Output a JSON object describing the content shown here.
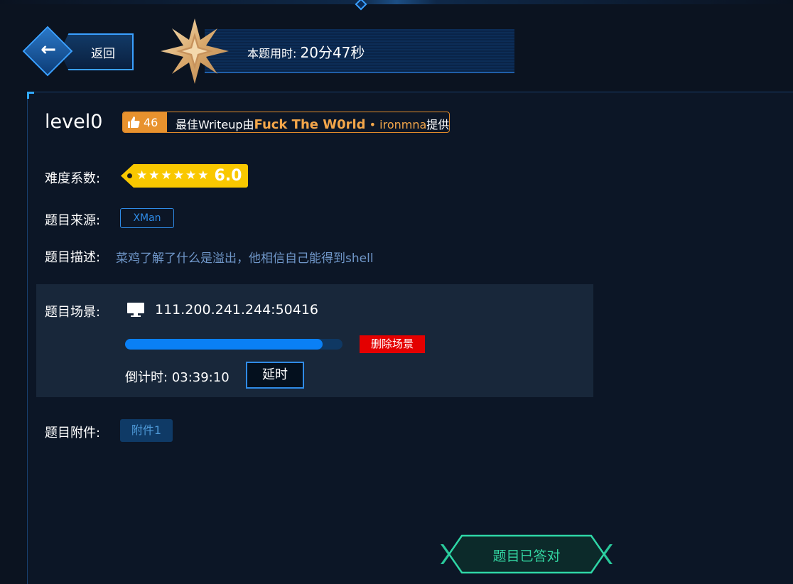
{
  "header": {
    "back_label": "返回",
    "timer_label": "本题用时:",
    "timer_value": "20分47秒"
  },
  "challenge": {
    "title": "level0",
    "likes": "46",
    "writeup_prefix": "最佳Writeup由",
    "writeup_team": "Fuck The W0rld",
    "writeup_sep": " • ",
    "writeup_user": "ironmna",
    "writeup_suffix": "提供",
    "difficulty_label": "难度系数:",
    "difficulty_stars": 6,
    "difficulty_score": "6.0",
    "source_label": "题目来源:",
    "source_value": "XMan",
    "desc_label": "题目描述:",
    "desc_value": "菜鸡了解了什么是溢出，他相信自己能得到shell",
    "scene_label": "题目场景:",
    "scene_address": "111.200.241.244:50416",
    "scene_progress": 0.91,
    "delete_scene_label": "删除场景",
    "countdown_label": "倒计时:",
    "countdown_value": "03:39:10",
    "extend_label": "延时",
    "attachment_label": "题目附件:",
    "attachment_button": "附件1",
    "answered_label": "题目已答对"
  },
  "colors": {
    "accent_blue": "#2f8be6",
    "writeup_orange": "#e8922e",
    "difficulty_yellow": "#f9c800",
    "danger_red": "#e40000",
    "success_green": "#33d6a2"
  },
  "icons": {
    "back": "arrow-left-icon",
    "badge": "star-badge-icon",
    "like": "thumbs-up-icon",
    "monitor": "monitor-icon"
  }
}
